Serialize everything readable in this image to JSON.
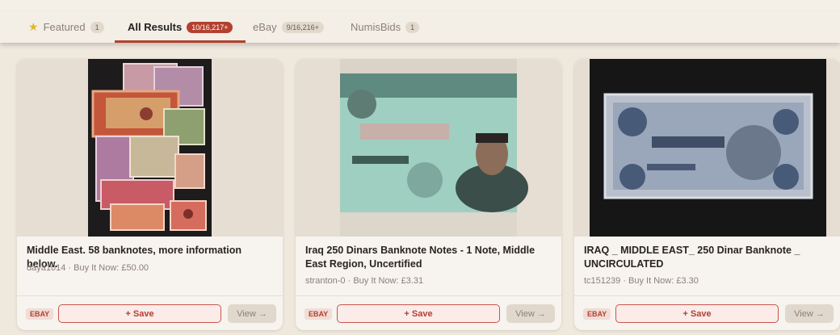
{
  "tabs": [
    {
      "label": "Featured",
      "count": "1",
      "icon": "star-icon"
    },
    {
      "label": "All Results",
      "count": "10/16,217+"
    },
    {
      "label": "eBay",
      "count": "9/16,216+"
    },
    {
      "label": "NumisBids",
      "count": "1"
    }
  ],
  "listings": [
    {
      "title": "Middle East. 58 banknotes, more information below.",
      "seller": "daya1014",
      "price_text": "Buy It Now: £50.00",
      "source": "EBAY",
      "save_label": "+ Save",
      "view_label": "View →"
    },
    {
      "title": "Iraq 250 Dinars Banknote Notes - 1 Note, Middle East Region, Uncertified",
      "seller": "stranton-0",
      "price_text": "Buy It Now: £3.31",
      "source": "EBAY",
      "save_label": "+ Save",
      "view_label": "View →"
    },
    {
      "title": "IRAQ _ MIDDLE EAST_ 250 Dinar Banknote _ UNCIRCULATED",
      "seller": "tc151239",
      "price_text": "Buy It Now: £3.30",
      "source": "EBAY",
      "save_label": "+ Save",
      "view_label": "View →"
    }
  ],
  "colors": {
    "accent": "#b3402e",
    "background": "#efe8dd",
    "card": "#f7f3ee"
  }
}
